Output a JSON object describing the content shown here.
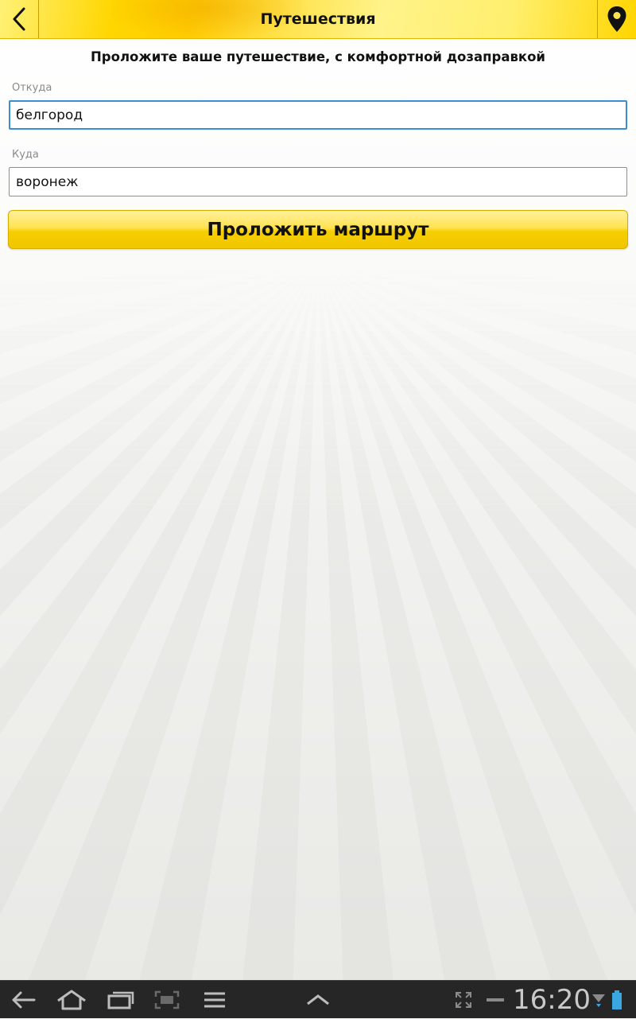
{
  "header": {
    "title": "Путешествия",
    "back_icon": "chevron-left-icon",
    "location_icon": "map-pin-icon"
  },
  "form": {
    "subtitle": "Проложите ваше путешествие, с комфортной дозаправкой",
    "from_label": "Откуда",
    "from_value": "белгород",
    "to_label": "Куда",
    "to_value": "воронеж",
    "submit_label": "Проложить маршрут"
  },
  "system_bar": {
    "time": "16:20",
    "icons": [
      "back-icon",
      "home-icon",
      "recent-apps-icon",
      "screenshot-icon",
      "menu-icon",
      "chevron-up-icon",
      "fullscreen-icon",
      "minus-icon",
      "wifi-icon",
      "battery-icon"
    ]
  },
  "colors": {
    "accent_yellow": "#ffd600",
    "focus_blue": "#3b8fd0",
    "nav_bar": "#262626"
  }
}
